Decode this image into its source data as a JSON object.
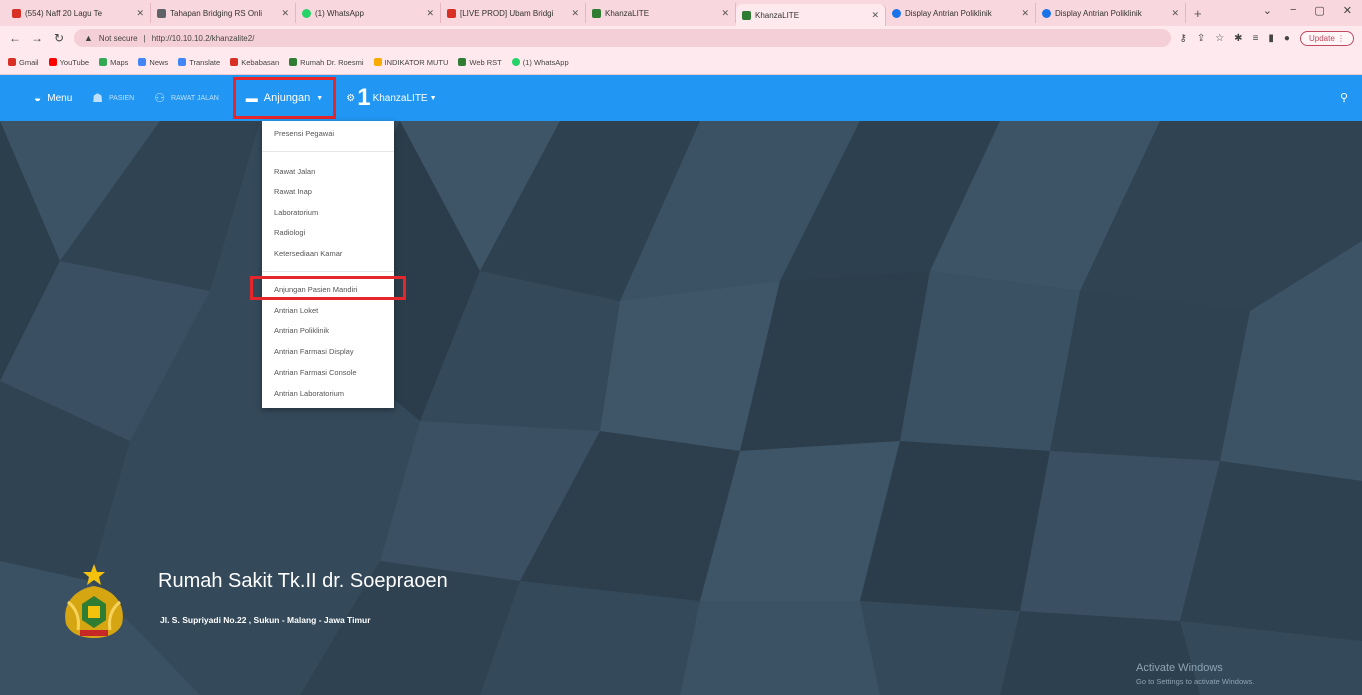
{
  "browser": {
    "tabs": [
      {
        "title": "(554) Naff 20 Lagu Te",
        "color": "#d93025"
      },
      {
        "title": "Tahapan Bridging RS Onli",
        "color": "#5f6368"
      },
      {
        "title": "(1) WhatsApp",
        "color": "#25d366"
      },
      {
        "title": "[LIVE PROD] Ubam Bridgi",
        "color": "#d93025"
      },
      {
        "title": "KhanzaLITE",
        "color": "#2e7d32"
      },
      {
        "title": "KhanzaLITE",
        "color": "#2e7d32"
      },
      {
        "title": "Display Antrian Poliklinik",
        "color": "#1a73e8"
      },
      {
        "title": "Display Antrian Poliklinik",
        "color": "#1a73e8"
      }
    ],
    "new_tab": "+",
    "window_controls": [
      "⌄",
      "−",
      "▢",
      "✕"
    ],
    "address": {
      "security": "Not secure",
      "url": "http://10.10.10.2/khanzalite2/"
    },
    "update_label": "Update ⋮",
    "bookmarks": [
      {
        "label": "Gmail",
        "color": "#d93025"
      },
      {
        "label": "YouTube",
        "color": "#ff0000"
      },
      {
        "label": "Maps",
        "color": "#34a853"
      },
      {
        "label": "News",
        "color": "#4285f4"
      },
      {
        "label": "Translate",
        "color": "#4285f4"
      },
      {
        "label": "Kebabasan",
        "color": "#d93025"
      },
      {
        "label": "Rumah Dr. Roesmi",
        "color": "#2e7d32"
      },
      {
        "label": "INDIKATOR MUTU",
        "color": "#f9ab00"
      },
      {
        "label": "Web RST",
        "color": "#2e7d32"
      },
      {
        "label": "(1) WhatsApp",
        "color": "#25d366"
      }
    ]
  },
  "navbar": {
    "menu_label": "Menu",
    "pasien_label": "PASIEN",
    "rawat_jalan_label": "RAWAT JALAN",
    "anjungan_label": "Anjungan",
    "khanza_prefix": "1",
    "khanza_label": "KhanzaLITE"
  },
  "dropdown": {
    "items": [
      "Presensi Pegawai",
      "Rawat Jalan",
      "Rawat Inap",
      "Laboratorium",
      "Radiologi",
      "Ketersediaan Kamar",
      "Anjungan Pasien Mandiri",
      "Antrian Loket",
      "Antrian Poliklinik",
      "Antrian Farmasi Display",
      "Antrian Farmasi Console",
      "Antrian Laboratorium"
    ]
  },
  "brand": {
    "title": "Rumah Sakit Tk.II dr. Soepraoen",
    "address": "Jl. S. Supriyadi No.22 , Sukun - Malang - Jawa Timur"
  },
  "windows_watermark": {
    "line1": "Activate Windows",
    "line2": "Go to Settings to activate Windows."
  },
  "colors": {
    "navbar": "#2196f3",
    "background": "#34495a",
    "highlight": "#e5262a"
  }
}
